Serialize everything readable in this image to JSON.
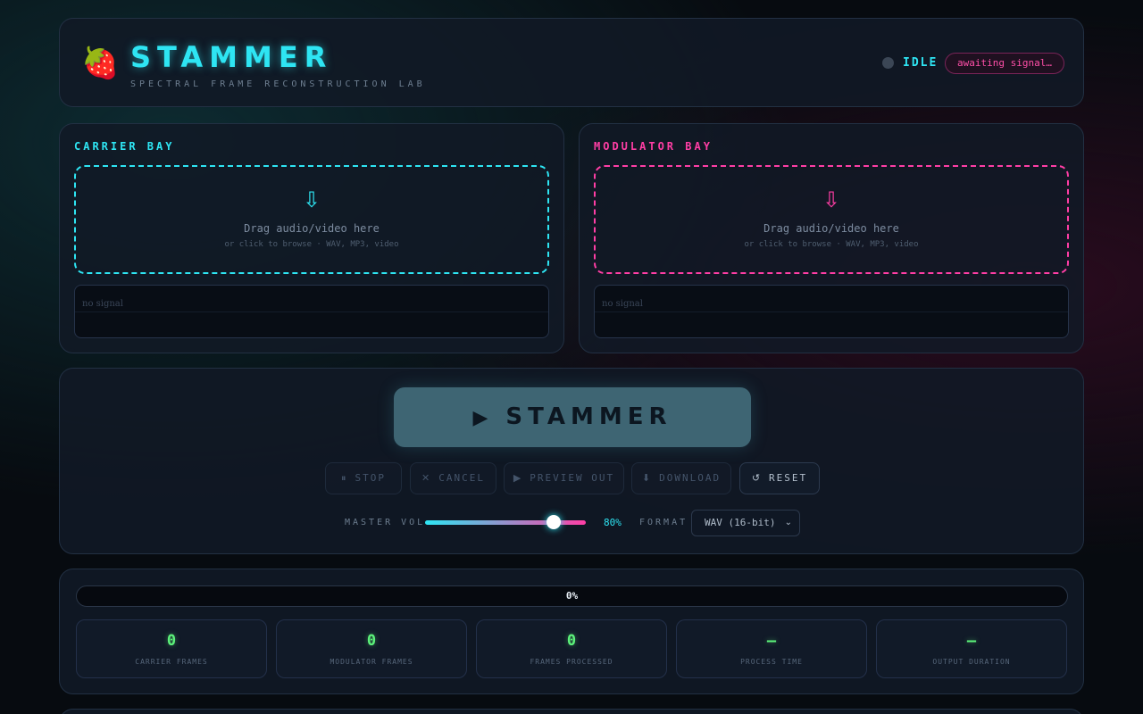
{
  "header": {
    "logo_icon": "🍓",
    "title": "STAMMER",
    "subtitle": "SPECTRAL FRAME RECONSTRUCTION LAB",
    "status": "IDLE",
    "status_message": "awaiting signal…"
  },
  "carrier": {
    "title": "CARRIER BAY",
    "drop_icon": "⇩",
    "drop_title": "Drag audio/video here",
    "drop_hint": "or click to browse · WAV, MP3, video",
    "signal": "no signal",
    "color": "#2ee5f3"
  },
  "modulator": {
    "title": "MODULATOR BAY",
    "drop_icon": "⇩",
    "drop_title": "Drag audio/video here",
    "drop_hint": "or click to browse · WAV, MP3, video",
    "signal": "no signal",
    "color": "#ff3ea5"
  },
  "controls": {
    "main_icon": "▶",
    "main_label": "STAMMER",
    "buttons": [
      {
        "icon": "⏸",
        "label": "STOP",
        "enabled": false
      },
      {
        "icon": "✕",
        "label": "CANCEL",
        "enabled": false
      },
      {
        "icon": "▶",
        "label": "PREVIEW OUT",
        "enabled": false
      },
      {
        "icon": "⬇",
        "label": "DOWNLOAD",
        "enabled": false
      },
      {
        "icon": "↺",
        "label": "RESET",
        "enabled": true
      }
    ],
    "volume_label": "MASTER VOL",
    "volume_value": "80%",
    "volume_fraction": 0.8,
    "format_label": "FORMAT",
    "format_value": "WAV (16-bit)",
    "format_chevron": "⌄"
  },
  "stats": {
    "progress_text": "0%",
    "progress_fraction": 0,
    "cards": [
      {
        "value": "0",
        "label": "CARRIER FRAMES"
      },
      {
        "value": "0",
        "label": "MODULATOR FRAMES"
      },
      {
        "value": "0",
        "label": "FRAMES PROCESSED"
      },
      {
        "value": "—",
        "label": "PROCESS TIME"
      },
      {
        "value": "—",
        "label": "OUTPUT DURATION"
      }
    ]
  }
}
